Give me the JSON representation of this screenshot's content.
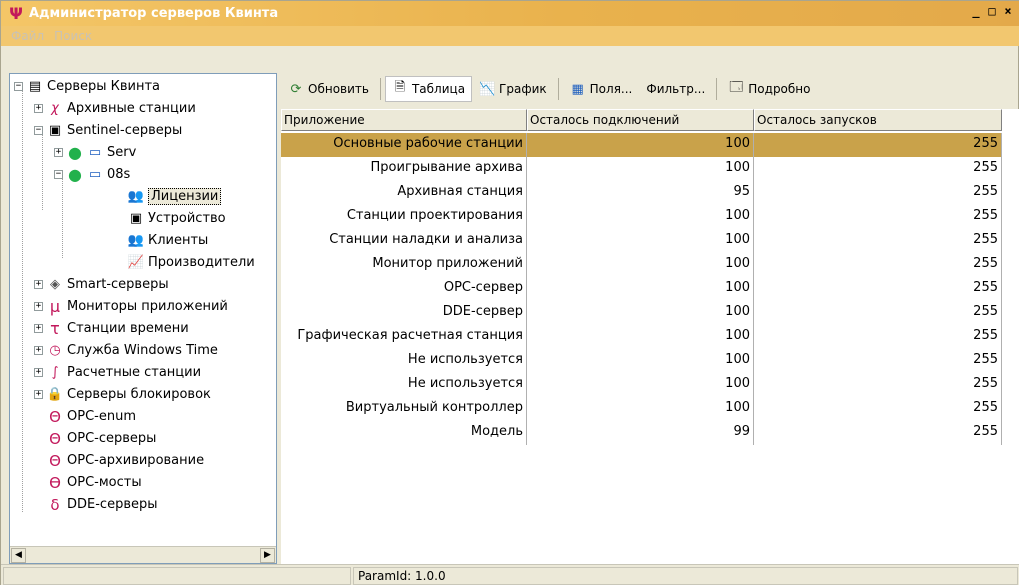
{
  "window": {
    "title": "Администратор серверов Квинта"
  },
  "menu": [
    "Файл",
    "Поиск"
  ],
  "tree": [
    {
      "label": "Серверы Квинта",
      "icon": "server-list-icon"
    },
    {
      "label": "Архивные станции",
      "icon": "archive-chi-icon"
    },
    {
      "label": "Sentinel-серверы",
      "icon": "sentinel-device-icon"
    },
    {
      "label": "Serv",
      "icon": "computer-online-icon"
    },
    {
      "label": "08s",
      "icon": "computer-online-icon"
    },
    {
      "label": "Лицензии",
      "icon": "users-icon"
    },
    {
      "label": "Устройство",
      "icon": "device-icon"
    },
    {
      "label": "Клиенты",
      "icon": "users-icon"
    },
    {
      "label": "Производители",
      "icon": "chart-icon"
    },
    {
      "label": "Smart-серверы",
      "icon": "smart-server-icon"
    },
    {
      "label": "Мониторы приложений",
      "icon": "mu-icon"
    },
    {
      "label": "Станции времени",
      "icon": "tau-icon"
    },
    {
      "label": "Служба Windows Time",
      "icon": "clock-icon"
    },
    {
      "label": "Расчетные станции",
      "icon": "integral-icon"
    },
    {
      "label": "Серверы блокировок",
      "icon": "lock-icon"
    },
    {
      "label": "OPC-enum",
      "icon": "theta-icon"
    },
    {
      "label": "OPC-серверы",
      "icon": "theta-icon"
    },
    {
      "label": "OPC-архивирование",
      "icon": "theta-icon"
    },
    {
      "label": "OPC-мосты",
      "icon": "theta-bridge-icon"
    },
    {
      "label": "DDE-серверы",
      "icon": "delta-icon"
    }
  ],
  "toolbar": {
    "refresh": "Обновить",
    "table": "Таблица",
    "graph": "График",
    "fields": "Поля...",
    "filter": "Фильтр...",
    "details": "Подробно"
  },
  "table": {
    "headers": [
      "Приложение",
      "Осталось подключений",
      "Осталось запусков"
    ],
    "rows": [
      {
        "app": "Основные рабочие станции",
        "conn": "100",
        "runs": "255"
      },
      {
        "app": "Проигрывание архива",
        "conn": "100",
        "runs": "255"
      },
      {
        "app": "Архивная станция",
        "conn": "95",
        "runs": "255"
      },
      {
        "app": "Станции проектирования",
        "conn": "100",
        "runs": "255"
      },
      {
        "app": "Станции наладки и анализа",
        "conn": "100",
        "runs": "255"
      },
      {
        "app": "Монитор приложений",
        "conn": "100",
        "runs": "255"
      },
      {
        "app": "OPC-сервер",
        "conn": "100",
        "runs": "255"
      },
      {
        "app": "DDE-сервер",
        "conn": "100",
        "runs": "255"
      },
      {
        "app": "Графическая расчетная станция",
        "conn": "100",
        "runs": "255"
      },
      {
        "app": "Не используется",
        "conn": "100",
        "runs": "255"
      },
      {
        "app": "Не используется",
        "conn": "100",
        "runs": "255"
      },
      {
        "app": "Виртуальный контроллер",
        "conn": "100",
        "runs": "255"
      },
      {
        "app": "Модель",
        "conn": "99",
        "runs": "255"
      }
    ]
  },
  "status": {
    "param": "ParamId: 1.0.0"
  }
}
